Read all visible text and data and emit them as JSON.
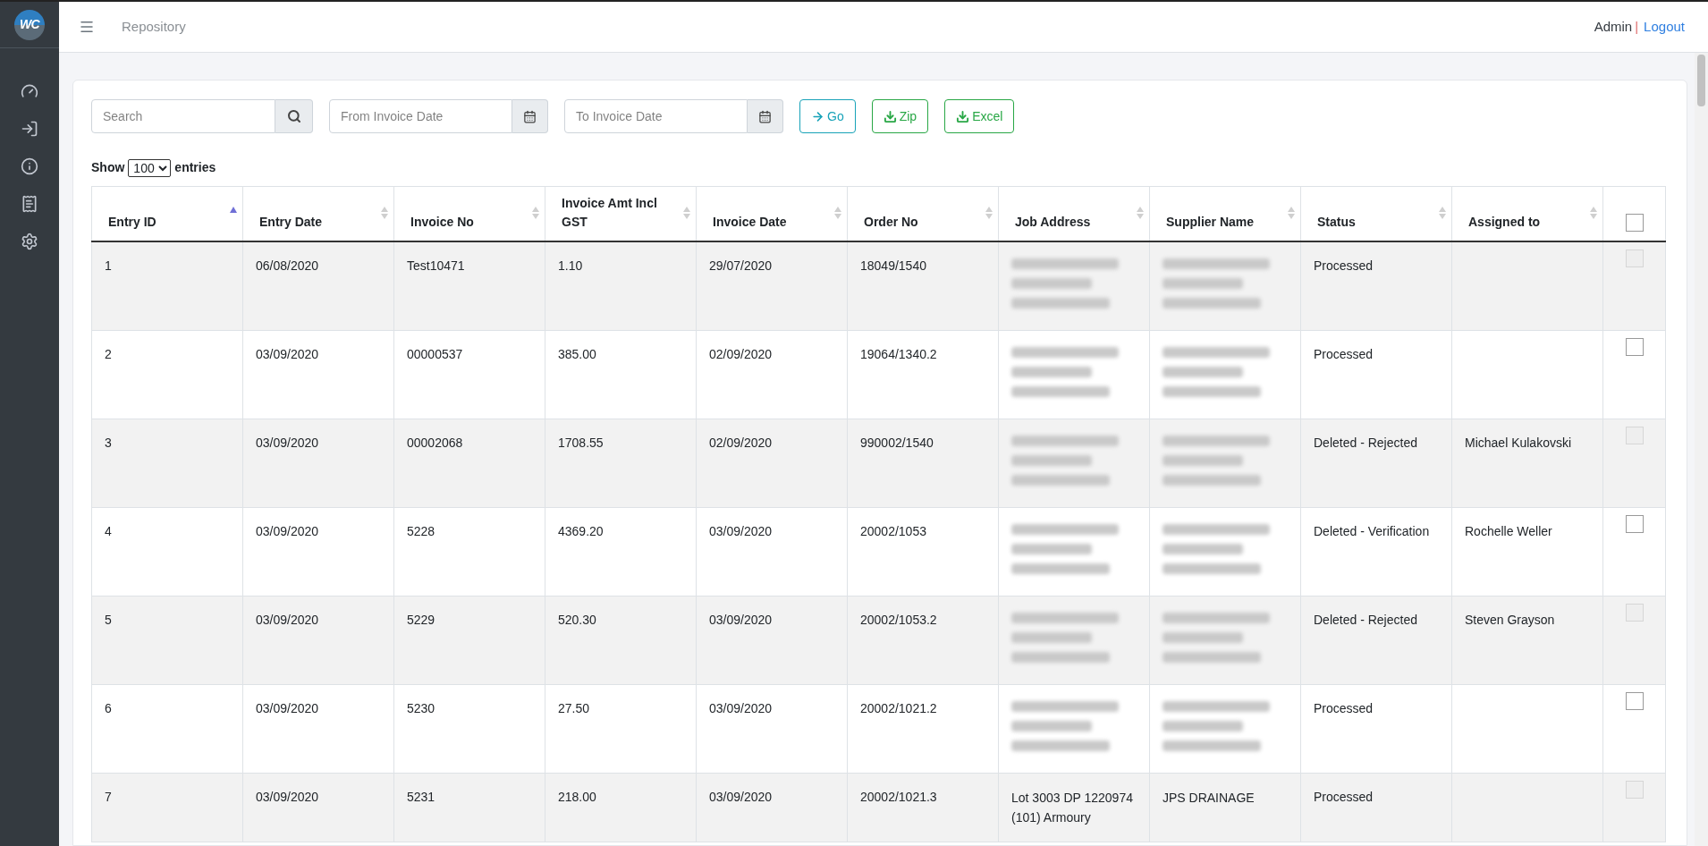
{
  "topbar": {
    "page_title": "Repository",
    "user": "Admin",
    "separator": "|",
    "logout": "Logout"
  },
  "sidebar": {
    "logo": "WC",
    "items": [
      {
        "kind": "gauge"
      },
      {
        "kind": "import"
      },
      {
        "kind": "info"
      },
      {
        "kind": "receipt"
      },
      {
        "kind": "settings"
      }
    ]
  },
  "filters": {
    "search": {
      "placeholder": "Search"
    },
    "from_date": {
      "placeholder": "From Invoice Date"
    },
    "to_date": {
      "placeholder": "To Invoice Date"
    },
    "buttons": [
      {
        "label": "Go",
        "kind": "go"
      },
      {
        "label": "Zip",
        "kind": "download"
      },
      {
        "label": "Excel",
        "kind": "download"
      }
    ]
  },
  "length": {
    "prefix": "Show",
    "value": "100",
    "suffix": "entries"
  },
  "table": {
    "columns": [
      {
        "label": "Entry ID",
        "sorted": true
      },
      {
        "label": "Entry Date",
        "sorted": false
      },
      {
        "label": "Invoice No",
        "sorted": false
      },
      {
        "label": "Invoice Amt Incl GST",
        "sorted": false
      },
      {
        "label": "Invoice Date",
        "sorted": false
      },
      {
        "label": "Order No",
        "sorted": false
      },
      {
        "label": "Job Address",
        "sorted": false
      },
      {
        "label": "Supplier Name",
        "sorted": false
      },
      {
        "label": "Status",
        "sorted": false
      },
      {
        "label": "Assigned to",
        "sorted": false
      }
    ],
    "header_checkbox": {
      "checked": false
    },
    "rows": [
      {
        "entry_id": "1",
        "entry_date": "06/08/2020",
        "invoice_no": "Test10471",
        "amount": "1.10",
        "invoice_date": "29/07/2020",
        "order_no": "18049/1540",
        "job_address": {
          "redacted": true
        },
        "supplier": {
          "redacted": true
        },
        "status": "Processed",
        "assigned_to": "",
        "checkbox": {
          "checked": false,
          "disabled": true
        }
      },
      {
        "entry_id": "2",
        "entry_date": "03/09/2020",
        "invoice_no": "00000537",
        "amount": "385.00",
        "invoice_date": "02/09/2020",
        "order_no": "19064/1340.2",
        "job_address": {
          "redacted": true
        },
        "supplier": {
          "redacted": true
        },
        "status": "Processed",
        "assigned_to": "",
        "checkbox": {
          "checked": false,
          "disabled": false
        }
      },
      {
        "entry_id": "3",
        "entry_date": "03/09/2020",
        "invoice_no": "00002068",
        "amount": "1708.55",
        "invoice_date": "02/09/2020",
        "order_no": "990002/1540",
        "job_address": {
          "redacted": true
        },
        "supplier": {
          "redacted": true
        },
        "status": "Deleted - Rejected",
        "assigned_to": "Michael Kulakovski",
        "checkbox": {
          "checked": false,
          "disabled": true
        }
      },
      {
        "entry_id": "4",
        "entry_date": "03/09/2020",
        "invoice_no": "5228",
        "amount": "4369.20",
        "invoice_date": "03/09/2020",
        "order_no": "20002/1053",
        "job_address": {
          "redacted": true
        },
        "supplier": {
          "redacted": true
        },
        "status": "Deleted - Verification",
        "assigned_to": "Rochelle Weller",
        "checkbox": {
          "checked": false,
          "disabled": false
        }
      },
      {
        "entry_id": "5",
        "entry_date": "03/09/2020",
        "invoice_no": "5229",
        "amount": "520.30",
        "invoice_date": "03/09/2020",
        "order_no": "20002/1053.2",
        "job_address": {
          "redacted": true
        },
        "supplier": {
          "redacted": true
        },
        "status": "Deleted - Rejected",
        "assigned_to": "Steven Grayson",
        "checkbox": {
          "checked": false,
          "disabled": true
        }
      },
      {
        "entry_id": "6",
        "entry_date": "03/09/2020",
        "invoice_no": "5230",
        "amount": "27.50",
        "invoice_date": "03/09/2020",
        "order_no": "20002/1021.2",
        "job_address": {
          "redacted": true
        },
        "supplier": {
          "redacted": true
        },
        "status": "Processed",
        "assigned_to": "",
        "checkbox": {
          "checked": false,
          "disabled": false
        }
      },
      {
        "entry_id": "7",
        "entry_date": "03/09/2020",
        "invoice_no": "5231",
        "amount": "218.00",
        "invoice_date": "03/09/2020",
        "order_no": "20002/1021.3",
        "job_address": {
          "redacted": false,
          "text": "Lot 3003 DP 1220974 (101) Armoury"
        },
        "supplier": {
          "redacted": false,
          "text": "JPS DRAINAGE"
        },
        "status": "Processed",
        "assigned_to": "",
        "checkbox": {
          "checked": false,
          "disabled": true
        }
      }
    ]
  }
}
